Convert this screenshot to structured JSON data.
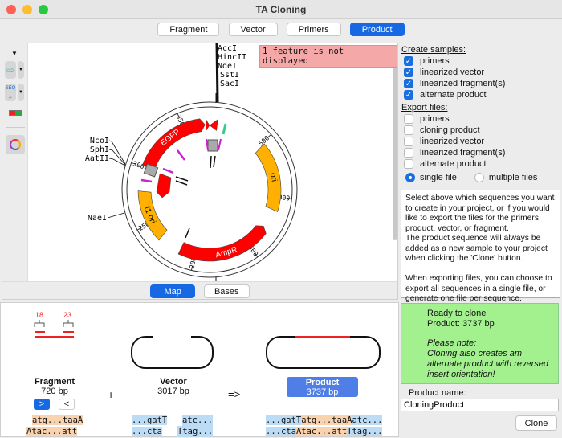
{
  "window": {
    "title": "TA Cloning"
  },
  "tabs": [
    {
      "label": "Fragment"
    },
    {
      "label": "Vector"
    },
    {
      "label": "Primers"
    },
    {
      "label": "Product",
      "selected": true
    }
  ],
  "map": {
    "warning": "1 feature is not displayed",
    "total_bp": 3737,
    "ticks": [
      "500",
      "1000",
      "1500",
      "2000",
      "2500",
      "3000",
      "3500"
    ],
    "sites_top": [
      "AccI",
      "HincII",
      "NdeI",
      "SstI",
      "SacI"
    ],
    "sites_left": [
      "NcoI",
      "SphI",
      "AatII"
    ],
    "site_nae": "NaeI",
    "features": [
      {
        "name": "EGFP",
        "start": 3010,
        "end": 3695,
        "color": "#ff0000",
        "label_color": "#ffffff"
      },
      {
        "name": "ori",
        "start": 519,
        "end": 1121,
        "color": "#ffb000",
        "label_color": "#000000"
      },
      {
        "name": "AmpR",
        "start": 1287,
        "end": 2138,
        "color": "#ff0000",
        "label_color": "#ffffff"
      },
      {
        "name": "f1 ori",
        "start": 2336,
        "end": 2792,
        "color": "#ffb000",
        "label_color": "#000000"
      }
    ],
    "view_tabs": [
      "Map",
      "Bases"
    ]
  },
  "options": {
    "create_title": "Create samples:",
    "create": [
      {
        "label": "primers",
        "checked": true
      },
      {
        "label": "linearized vector",
        "checked": true
      },
      {
        "label": "linearized fragment(s)",
        "checked": true
      },
      {
        "label": "alternate product",
        "checked": true
      }
    ],
    "export_title": "Export files:",
    "export": [
      {
        "label": "primers",
        "checked": false
      },
      {
        "label": "cloning product",
        "checked": false
      },
      {
        "label": "linearized vector",
        "checked": false
      },
      {
        "label": "linearized fragment(s)",
        "checked": false
      },
      {
        "label": "alternate product",
        "checked": false
      }
    ],
    "radio": [
      {
        "label": "single file",
        "selected": true
      },
      {
        "label": "multiple files",
        "selected": false
      }
    ],
    "help": "Select above which sequences you want to create in your project, or if you would like to export the files for the primers, product, vector, or fragment.\nThe product sequence will always be added as a new sample to your project when clicking the 'Clone' button.\n\nWhen exporting files, you can choose to export all sequences in a single file, or generate one file per sequence."
  },
  "summary": {
    "overhang_left": "18",
    "overhang_right": "23",
    "fragment": {
      "name": "Fragment",
      "size": "720 bp",
      "fwd_btn": ">",
      "rev_btn": "<",
      "top": [
        "atg...taa",
        "A"
      ],
      "bottom": [
        "A",
        "tac...att"
      ]
    },
    "plus": "+",
    "arrow": "=>",
    "vector": {
      "name": "Vector",
      "size": "3017 bp",
      "top_l": "...gatT",
      "top_r": "atc...",
      "bot_l": "...cta",
      "bot_r": "Ttag..."
    },
    "product": {
      "name": "Product",
      "size": "3737 bp",
      "top": [
        "...gatT",
        "atg...taaA",
        "atc..."
      ],
      "bottom": [
        "...cta",
        "Atac...att",
        "Ttag..."
      ]
    }
  },
  "status": {
    "title": "Ready to clone",
    "product": "Product: 3737 bp",
    "note_title": "Please note:",
    "note": "Cloning also creates am alternate product with reversed insert orientation!"
  },
  "product_name": {
    "label": "Product name:",
    "value": "CloningProduct"
  },
  "clone_button": "Clone",
  "colors": {
    "accent": "#1668e3",
    "status_bg": "#a3f18e",
    "fragment_seq": "#f9d2b0",
    "vector_seq": "#bcdcf6"
  }
}
